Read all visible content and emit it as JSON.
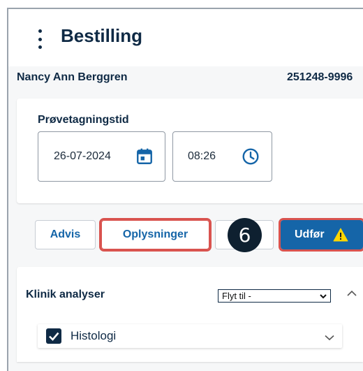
{
  "header": {
    "title": "Bestilling",
    "menu_icon": "kebab-menu-icon"
  },
  "patient": {
    "name": "Nancy Ann Berggren",
    "id": "251248-9996"
  },
  "sampling": {
    "label": "Prøvetagningstid",
    "date_value": "26-07-2024",
    "date_icon": "calendar-icon",
    "time_value": "08:26",
    "time_icon": "clock-icon"
  },
  "actions": {
    "advis": "Advis",
    "oplysninger": "Oplysninger",
    "blank": "",
    "udfor": "Udfør",
    "udfor_icon": "warning-icon",
    "step_number": "6"
  },
  "analyses": {
    "title": "Klinik analyser",
    "move_to_selected": "Flyt til -",
    "items": [
      {
        "label": "Histologi",
        "checked": true
      }
    ]
  },
  "colors": {
    "brand": "#0f2a45",
    "primary": "#1565a8",
    "highlight": "#d9534f",
    "warning": "#ffd600"
  }
}
